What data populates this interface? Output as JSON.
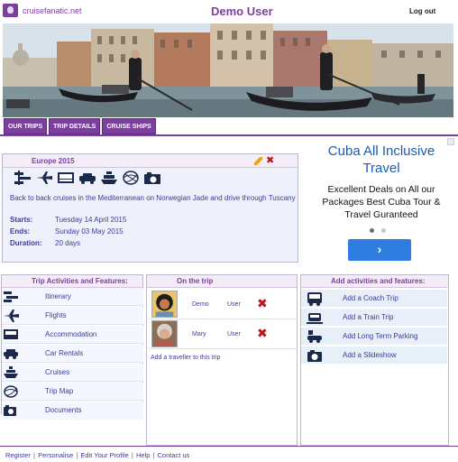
{
  "header": {
    "logo_text": "cruisefanatic.net",
    "user_name": "Demo User",
    "logout_label": "Log out"
  },
  "nav": {
    "tabs": [
      "OUR TRIPS",
      "TRIP DETAILS",
      "CRUISE SHIPS"
    ]
  },
  "trip": {
    "name": "Europe 2015",
    "description": "Back to back cruises in the Mediterranean on Norwegian Jade and drive through Tuscany",
    "starts_label": "Starts:",
    "starts": "Tuesday 14 April 2015",
    "ends_label": "Ends:",
    "ends": "Sunday 03 May 2015",
    "duration_label": "Duration:",
    "duration": "20 days",
    "icons": [
      "itinerary-icon",
      "flights-icon",
      "accommodation-icon",
      "car-icon",
      "cruise-icon",
      "map-icon",
      "documents-icon"
    ]
  },
  "ad": {
    "title": "Cuba All Inclusive Travel",
    "body": "Excellent Deals on All our Packages Best Cuba Tour & Travel Guranteed",
    "button": "›"
  },
  "activities": {
    "heading": "Trip Activities and Features:",
    "items": [
      {
        "label": "Itinerary",
        "icon": "itinerary-icon"
      },
      {
        "label": "Flights",
        "icon": "plane-icon"
      },
      {
        "label": "Accommodation",
        "icon": "bed-icon"
      },
      {
        "label": "Car Rentals",
        "icon": "car-icon"
      },
      {
        "label": "Cruises",
        "icon": "ship-icon"
      },
      {
        "label": "Trip Map",
        "icon": "globe-icon"
      },
      {
        "label": "Documents",
        "icon": "camera-icon"
      }
    ]
  },
  "on_trip": {
    "heading": "On the trip",
    "travellers": [
      {
        "name": "Demo",
        "role": "User"
      },
      {
        "name": "Mary",
        "role": "User"
      }
    ],
    "add_label": "Add a traveller to this trip"
  },
  "features": {
    "heading": "Add activities and features:",
    "items": [
      {
        "label": "Add a Coach Trip",
        "icon": "bus-icon"
      },
      {
        "label": "Add a Train Trip",
        "icon": "train-icon"
      },
      {
        "label": "Add Long Term Parking",
        "icon": "parking-icon"
      },
      {
        "label": "Add a Slideshow",
        "icon": "camera-icon"
      }
    ]
  },
  "footer": {
    "links": [
      "Register",
      "Personalise",
      "Edit Your Profile",
      "Help",
      "Contact us"
    ]
  }
}
